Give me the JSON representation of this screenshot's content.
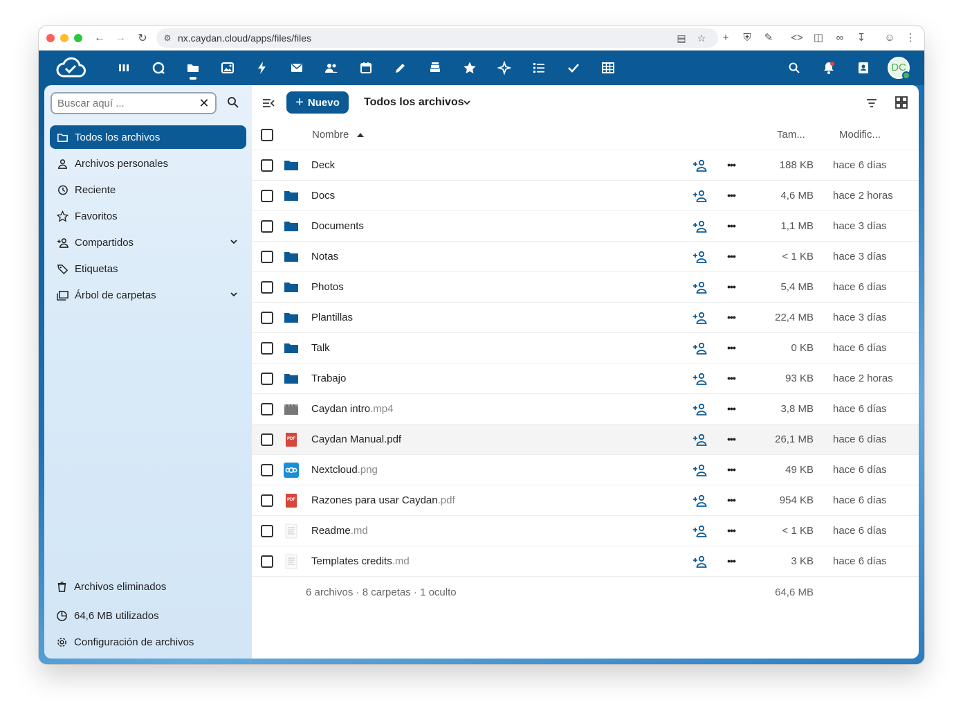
{
  "browser": {
    "url": "nx.caydan.cloud/apps/files/files"
  },
  "search": {
    "placeholder": "Buscar aquí ..."
  },
  "sidebar": {
    "items": [
      {
        "label": "Todos los archivos"
      },
      {
        "label": "Archivos personales"
      },
      {
        "label": "Reciente"
      },
      {
        "label": "Favoritos"
      },
      {
        "label": "Compartidos"
      },
      {
        "label": "Etiquetas"
      },
      {
        "label": "Árbol de carpetas"
      }
    ],
    "footer": {
      "deleted": "Archivos eliminados",
      "usage": "64,6 MB utilizados",
      "settings": "Configuración de archivos"
    }
  },
  "toolbar": {
    "new_label": "Nuevo",
    "breadcrumb": "Todos los archivos"
  },
  "table": {
    "headers": {
      "name": "Nombre",
      "size": "Tam...",
      "modified": "Modific..."
    },
    "rows": [
      {
        "name": "Deck",
        "ext": "",
        "type": "folder",
        "size": "188 KB",
        "modified": "hace 6 días"
      },
      {
        "name": "Docs",
        "ext": "",
        "type": "folder",
        "size": "4,6 MB",
        "modified": "hace 2 horas"
      },
      {
        "name": "Documents",
        "ext": "",
        "type": "folder",
        "size": "1,1 MB",
        "modified": "hace 3 días"
      },
      {
        "name": "Notas",
        "ext": "",
        "type": "folder",
        "size": "< 1 KB",
        "modified": "hace 3 días"
      },
      {
        "name": "Photos",
        "ext": "",
        "type": "folder",
        "size": "5,4 MB",
        "modified": "hace 6 días"
      },
      {
        "name": "Plantillas",
        "ext": "",
        "type": "folder",
        "size": "22,4 MB",
        "modified": "hace 3 días"
      },
      {
        "name": "Talk",
        "ext": "",
        "type": "folder",
        "size": "0 KB",
        "modified": "hace 6 días"
      },
      {
        "name": "Trabajo",
        "ext": "",
        "type": "folder",
        "size": "93 KB",
        "modified": "hace 2 horas"
      },
      {
        "name": "Caydan intro",
        "ext": ".mp4",
        "type": "video",
        "size": "3,8 MB",
        "modified": "hace 6 días"
      },
      {
        "name": "Caydan Manual.pdf",
        "ext": "",
        "type": "pdf",
        "size": "26,1 MB",
        "modified": "hace 6 días"
      },
      {
        "name": "Nextcloud",
        "ext": ".png",
        "type": "image",
        "size": "49 KB",
        "modified": "hace 6 días"
      },
      {
        "name": "Razones para usar Caydan",
        "ext": ".pdf",
        "type": "pdf",
        "size": "954 KB",
        "modified": "hace 6 días"
      },
      {
        "name": "Readme",
        "ext": ".md",
        "type": "text",
        "size": "< 1 KB",
        "modified": "hace 6 días"
      },
      {
        "name": "Templates credits",
        "ext": ".md",
        "type": "text",
        "size": "3 KB",
        "modified": "hace 6 días"
      }
    ],
    "summary": "6 archivos · 8 carpetas · 1 oculto",
    "total_size": "64,6 MB"
  },
  "user": {
    "initials": "DC"
  },
  "icons": {
    "pdf_badge": "PDF"
  },
  "colors": {
    "primary": "#0b5a96",
    "folder": "#0b5a96",
    "pdf": "#d7453b"
  }
}
